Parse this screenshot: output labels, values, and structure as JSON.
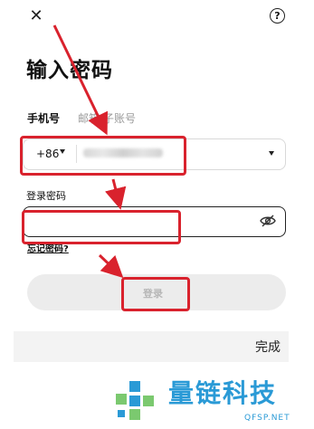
{
  "header": {
    "close_icon": "close-icon",
    "help_icon": "help-icon",
    "help_glyph": "?"
  },
  "page": {
    "title": "输入密码"
  },
  "tabs": [
    {
      "label": "手机号",
      "active": true
    },
    {
      "label": "邮箱/子账号",
      "active": false
    }
  ],
  "phone": {
    "country_code": "+86",
    "number_masked": "",
    "caret_icon": "caret-down-icon"
  },
  "password": {
    "label": "登录密码",
    "value": "",
    "visibility_icon": "eye-off-icon"
  },
  "links": {
    "forgot": "忘记密码?"
  },
  "actions": {
    "login_label": "登录"
  },
  "keyboard_bar": {
    "done_label": "完成"
  },
  "watermark": {
    "brand": "量链科技",
    "domain": "QFSP.NET",
    "color": "#2a9ad6"
  },
  "annotation_color": "#d9222d"
}
